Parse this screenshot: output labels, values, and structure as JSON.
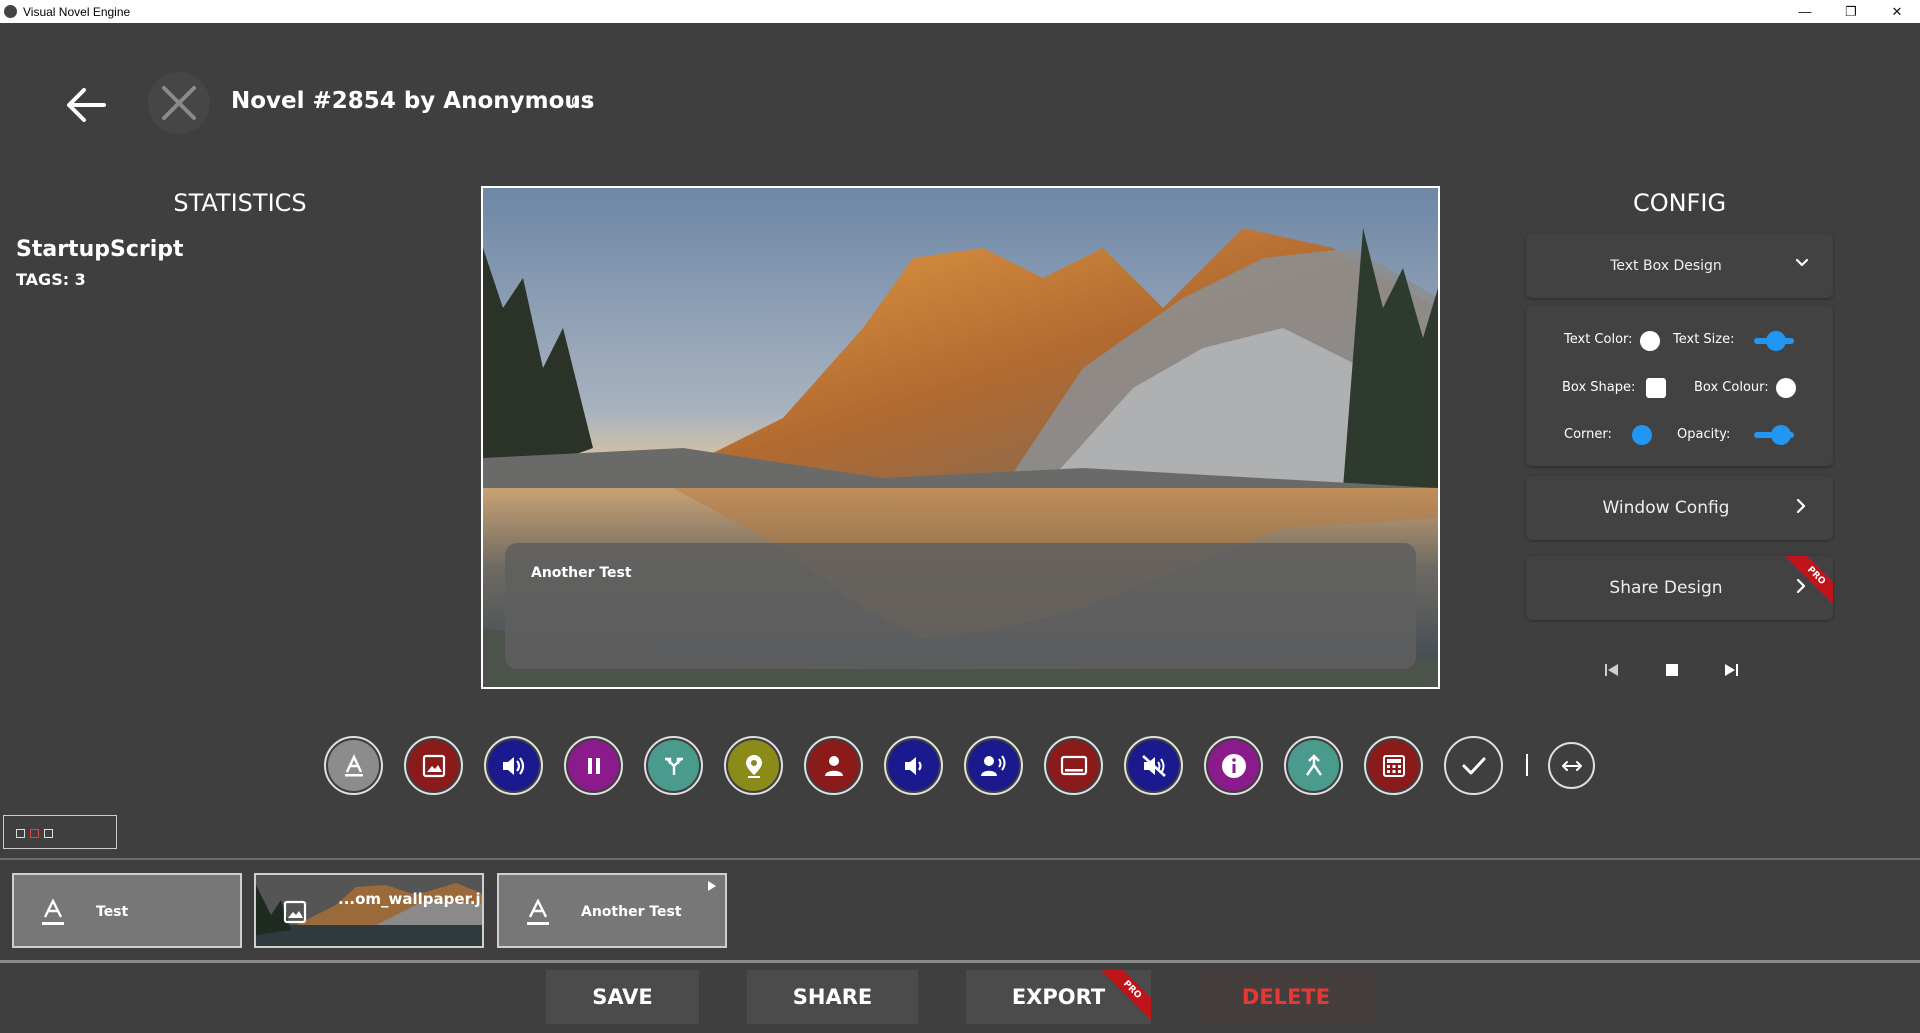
{
  "window": {
    "title": "Visual Novel Engine",
    "controls": {
      "minimize": "—",
      "restore": "❐",
      "close": "✕"
    }
  },
  "header": {
    "title": "Novel #2854 by Anonymous",
    "version": "0.1"
  },
  "statistics": {
    "heading": "STATISTICS",
    "script_name": "StartupScript",
    "tags": "TAGS: 3"
  },
  "preview": {
    "textbox_text": "Another Test"
  },
  "config": {
    "heading": "CONFIG",
    "dropdown_label": "Text Box Design",
    "options": {
      "text_color": "Text Color:",
      "text_size": "Text Size:",
      "box_shape": "Box Shape:",
      "box_colour": "Box Colour:",
      "corner": "Corner:",
      "opacity": "Opacity:"
    },
    "window_config": "Window Config",
    "share_design": "Share Design",
    "pro_badge": "PRO"
  },
  "toolbar": {
    "accent_colors": {
      "text": "#8c8c8c",
      "image": "#8b1a1a",
      "sound": "#1a1a8e",
      "pause": "#8b1a8b",
      "choice": "#4a9a8e",
      "location": "#8b8b1a",
      "character": "#8b1a1a",
      "volume": "#1a1a8e",
      "voice": "#1a1a8e",
      "textbox": "#8b1a1a",
      "mute": "#1a1a8e",
      "info": "#8b1a8b",
      "jump": "#4a9a8e",
      "calculator": "#8b1a1a",
      "done": "#3f3f3f",
      "swap": "#3f3f3f"
    }
  },
  "timeline": {
    "items": [
      {
        "label": "Test",
        "icon": "text-icon"
      },
      {
        "label": "...om_wallpaper.jpg",
        "icon": "image-icon"
      },
      {
        "label": "Another Test",
        "icon": "text-icon"
      }
    ]
  },
  "buttons": {
    "save": "SAVE",
    "share": "SHARE",
    "export": "EXPORT",
    "delete": "DELETE",
    "export_badge": "PRO"
  }
}
